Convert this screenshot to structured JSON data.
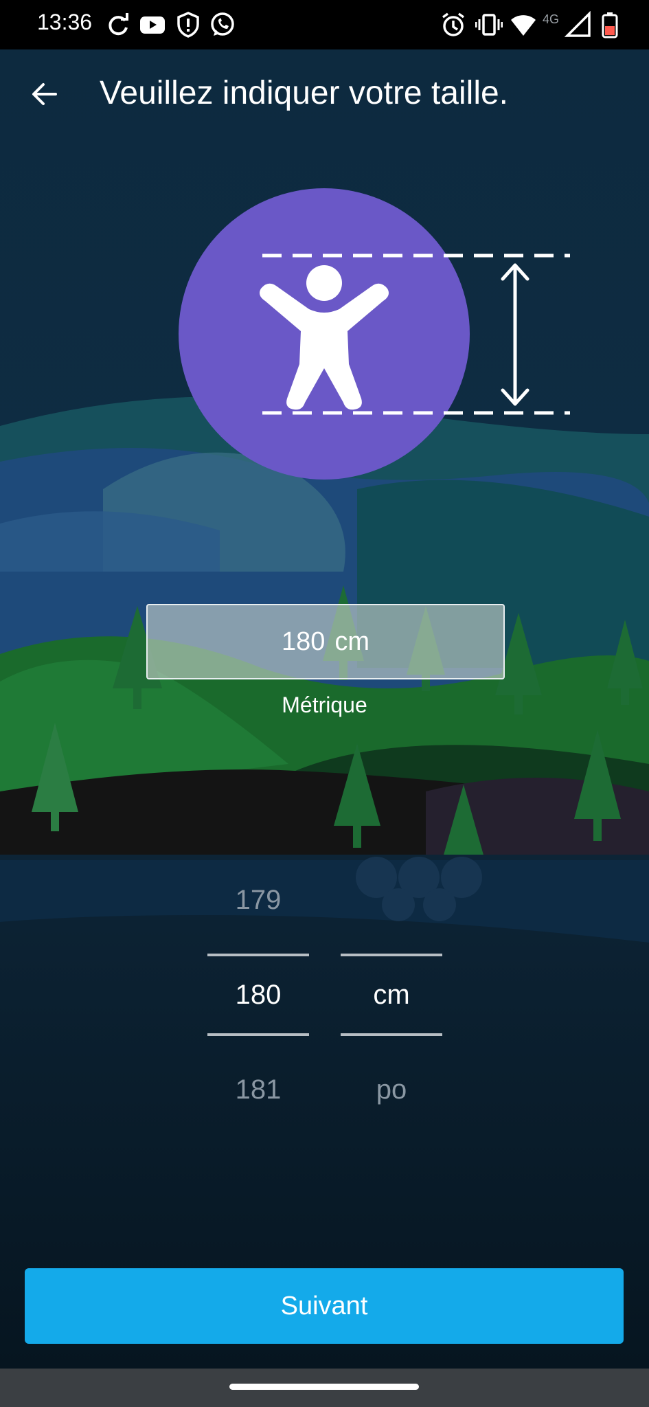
{
  "status_bar": {
    "time": "13:36",
    "network_label": "4G",
    "icons": [
      "sync-icon",
      "youtube-icon",
      "shield-icon",
      "whatsapp-icon",
      "alarm-icon",
      "vibrate-icon",
      "wifi-icon",
      "signal-icon",
      "battery-icon"
    ]
  },
  "header": {
    "title": "Veuillez indiquer votre taille.",
    "back_icon": "back-arrow-icon"
  },
  "illustration": {
    "circle_color": "#6a58c7",
    "icon": "person-height-icon"
  },
  "height_display": {
    "value": "180",
    "unit": "cm",
    "system_label": "Métrique"
  },
  "picker": {
    "value_column": {
      "prev": "179",
      "selected": "180",
      "next": "181"
    },
    "unit_column": {
      "selected": "cm",
      "next": "po"
    }
  },
  "footer": {
    "next_label": "Suivant",
    "accent": "#14aaea"
  }
}
